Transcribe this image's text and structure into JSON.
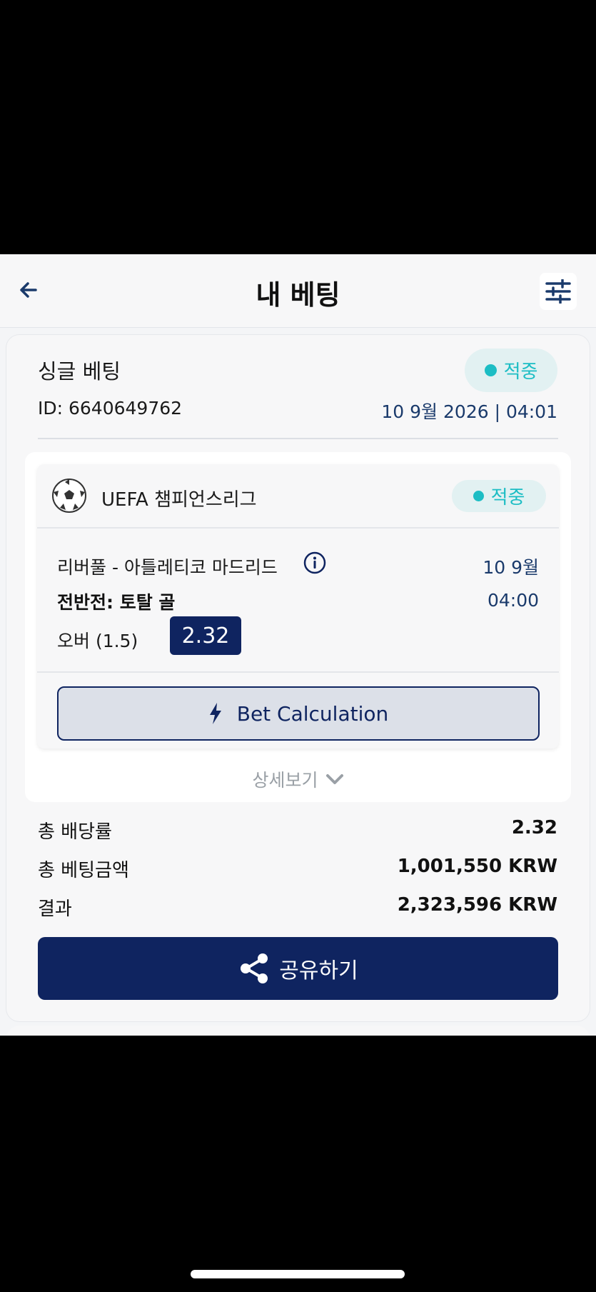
{
  "header": {
    "title": "내 베팅"
  },
  "bet": {
    "type": "싱글 베팅",
    "status": "적중",
    "id_label": "ID: 6640649762",
    "datetime": "10 9월 2026 | 04:01"
  },
  "match": {
    "league": "UEFA 챔피언스리그",
    "status": "적중",
    "teams": "리버풀 - 아틀레티코 마드리드",
    "date": "10 9월",
    "market": "전반전: 토탈 골",
    "time": "04:00",
    "selection": "오버 (1.5)",
    "odds": "2.32",
    "calc_label": "Bet Calculation",
    "details_label": "상세보기"
  },
  "summary": {
    "total_odds_label": "총 배당률",
    "total_odds": "2.32",
    "total_stake_label": "총 베팅금액",
    "total_stake": "1,001,550 KRW",
    "result_label": "결과",
    "result": "2,323,596 KRW"
  },
  "share": {
    "label": "공유하기"
  },
  "icons": {
    "back": "arrow-left-icon",
    "filter": "sliders-icon",
    "ball": "soccer-ball-icon",
    "info": "info-icon",
    "bolt": "lightning-icon",
    "chevron": "chevron-down-icon",
    "share": "share-icon"
  },
  "colors": {
    "brand": "#0f2460",
    "success": "#1cbdc4",
    "success_bg": "#e2f1f2"
  }
}
